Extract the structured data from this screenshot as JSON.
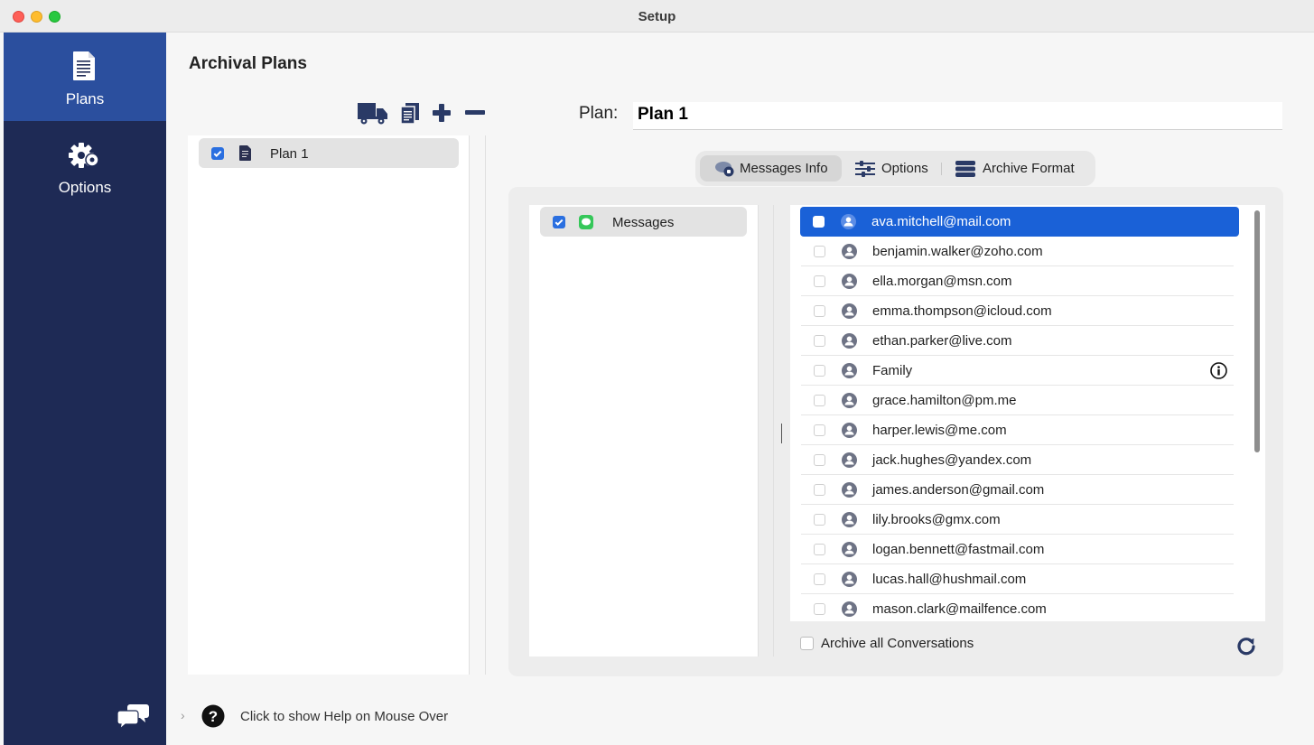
{
  "window": {
    "title": "Setup"
  },
  "sidebar": {
    "items": [
      {
        "label": "Plans",
        "icon": "document-icon",
        "active": true
      },
      {
        "label": "Options",
        "icon": "gear-icon",
        "active": false
      }
    ],
    "bottom_icon": "chat-bubbles-icon"
  },
  "main": {
    "heading": "Archival Plans",
    "toolbar": [
      "truck-icon",
      "duplicate-icon",
      "plus-icon",
      "minus-icon"
    ],
    "plans": [
      {
        "name": "Plan 1",
        "checked": true
      }
    ],
    "plan_label": "Plan:",
    "plan_name": "Plan 1"
  },
  "tabs": [
    {
      "label": "Messages Info",
      "active": true
    },
    {
      "label": "Options",
      "active": false
    },
    {
      "label": "Archive Format",
      "active": false
    }
  ],
  "sources": [
    {
      "name": "Messages",
      "checked": true
    }
  ],
  "conversations": [
    {
      "name": "ava.mitchell@mail.com",
      "selected": true
    },
    {
      "name": "benjamin.walker@zoho.com"
    },
    {
      "name": "ella.morgan@msn.com"
    },
    {
      "name": "emma.thompson@icloud.com"
    },
    {
      "name": "ethan.parker@live.com"
    },
    {
      "name": "Family",
      "info": true
    },
    {
      "name": "grace.hamilton@pm.me"
    },
    {
      "name": "harper.lewis@me.com"
    },
    {
      "name": "jack.hughes@yandex.com"
    },
    {
      "name": "james.anderson@gmail.com"
    },
    {
      "name": "lily.brooks@gmx.com"
    },
    {
      "name": "logan.bennett@fastmail.com"
    },
    {
      "name": "lucas.hall@hushmail.com"
    },
    {
      "name": "mason.clark@mailfence.com"
    }
  ],
  "archive_all": {
    "label": "Archive all Conversations",
    "checked": false
  },
  "help": {
    "label": "Click to show Help on Mouse Over"
  },
  "colors": {
    "sidebar": "#1e2a55",
    "sidebar_active": "#2b4f9e",
    "selection": "#1a61d7",
    "checkbox": "#2a6fe0"
  }
}
